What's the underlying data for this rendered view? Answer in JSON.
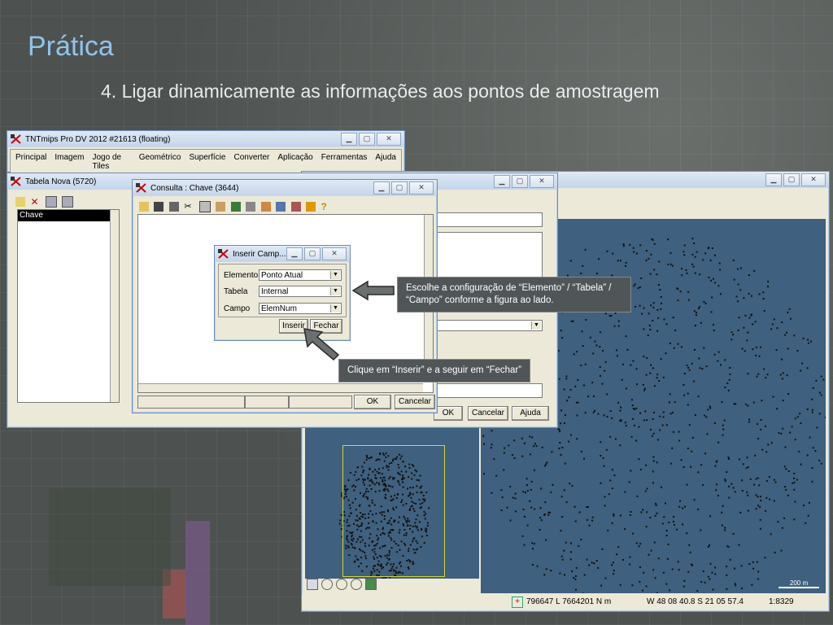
{
  "slide": {
    "title": "Prática",
    "subtitle": "4. Ligar dinamicamente as informações aos pontos de amostragem"
  },
  "main_window": {
    "title": "TNTmips Pro DV 2012  #21613 (floating)",
    "menu": [
      "Principal",
      "Imagem",
      "Jogo de Tiles",
      "Geométrico",
      "Superfície",
      "Converter",
      "Aplicação",
      "Ferramentas",
      "Ajuda"
    ]
  },
  "tabela_window": {
    "title": "Tabela Nova (5720)",
    "list_item": "Chave",
    "ok": "OK",
    "cancel": "Cancelar",
    "help": "Ajuda"
  },
  "consulta_window": {
    "title": "Consulta : Chave (3644)",
    "ok": "OK",
    "cancel": "Cancelar"
  },
  "inserir_dialog": {
    "title": "Inserir Camp...",
    "element_label": "Elemento",
    "element_value": "Ponto Atual",
    "table_label": "Tabela",
    "table_value": "Internal",
    "field_label": "Campo",
    "field_value": "ElemNum",
    "insert": "Inserir",
    "close": "Fechar"
  },
  "callouts": {
    "config": "Escolhe a configuração de “Elemento” / “Tabela” / “Campo” conforme a figura ao lado.",
    "insert": "Clique em “Inserir” e a seguir em “Fechar”"
  },
  "map_view": {
    "scale_bar": "200 m",
    "coords": "796647 L  7664201 N m",
    "latlon": "W 48 08 40.8  S 21 05 57.4",
    "scale": "1:8329"
  },
  "colors": {
    "title_blue": "#8fc3ee",
    "map_blue": "#3f607e",
    "callout_bg": "#505658"
  }
}
